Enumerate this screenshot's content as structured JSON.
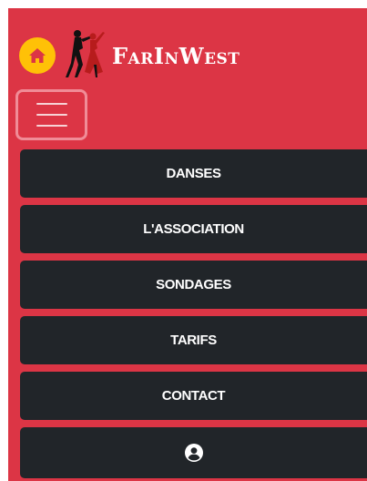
{
  "brand": {
    "name": "FarInWest",
    "home_icon": "home-icon",
    "logo_icon": "dancers-logo-icon"
  },
  "toggler": {
    "icon": "hamburger-menu-icon"
  },
  "menu": {
    "items": [
      {
        "label": "DANSES"
      },
      {
        "label": "L'ASSOCIATION"
      },
      {
        "label": "SONDAGES"
      },
      {
        "label": "TARIFS"
      },
      {
        "label": "CONTACT"
      }
    ],
    "account_icon": "user-circle-icon"
  },
  "colors": {
    "navbar_bg": "#dc3545",
    "menu_item_bg": "#212529",
    "home_button_bg": "#ffc107",
    "home_icon": "#dc3545",
    "text": "#ffffff"
  }
}
